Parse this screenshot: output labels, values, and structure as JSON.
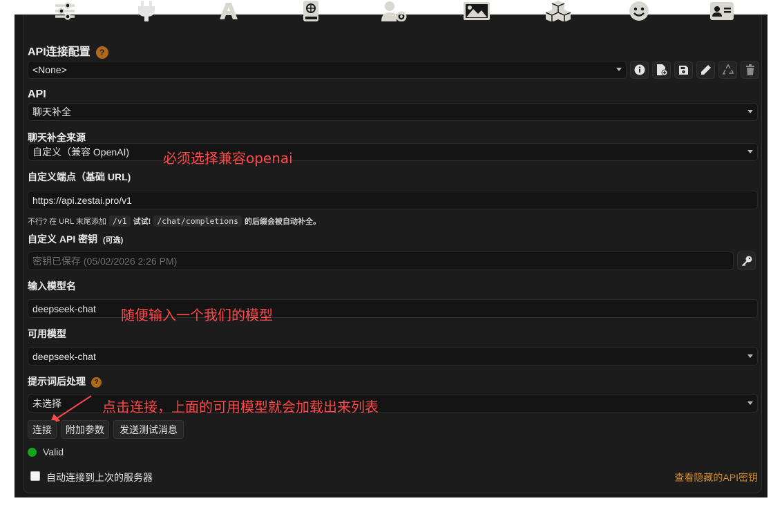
{
  "top_nav": {
    "icons": [
      "sliders-icon",
      "plug-icon",
      "font-icon",
      "book-icon",
      "user-gear-icon",
      "image-icon",
      "cubes-icon",
      "smiley-icon",
      "id-card-icon"
    ]
  },
  "api_conn": {
    "title": "API连接配置",
    "help": "?",
    "preset_value": "<None>"
  },
  "api": {
    "label": "API",
    "value": "聊天补全"
  },
  "source": {
    "label": "聊天补全来源",
    "value": "自定义（兼容 OpenAI)"
  },
  "endpoint": {
    "label": "自定义端点（基础 URL)",
    "value": "https://api.zestai.pro/v1",
    "hint_prefix": "不行? 在 URL 末尾添加",
    "hint_code1": "/v1",
    "hint_mid": "试试!",
    "hint_code2": "/chat/completions",
    "hint_suffix": "的后缀会被自动补全。"
  },
  "api_key": {
    "label": "自定义 API 密钥",
    "optional": "(可选)",
    "placeholder": "密钥已保存 (05/02/2026 2:26 PM)"
  },
  "model_input": {
    "label": "输入模型名",
    "value": "deepseek-chat"
  },
  "available_models": {
    "label": "可用模型",
    "value": "deepseek-chat"
  },
  "post_processing": {
    "label": "提示词后处理",
    "help": "?",
    "value": "未选择"
  },
  "buttons": {
    "connect": "连接",
    "extra_params": "附加参数",
    "send_test": "发送测试消息"
  },
  "status": {
    "text": "Valid",
    "color": "#15a31c"
  },
  "auto_connect": {
    "label": "自动连接到上次的服务器",
    "checked": false
  },
  "view_keys_link": "查看隐藏的API密钥",
  "annotations": {
    "source_note": "必须选择兼容openai",
    "model_note": "随便输入一个我们的模型",
    "connect_note": "点击连接，上面的可用模型就会加载出来列表"
  },
  "colors": {
    "accent": "#d28a2a",
    "annotation": "#ff4848"
  }
}
